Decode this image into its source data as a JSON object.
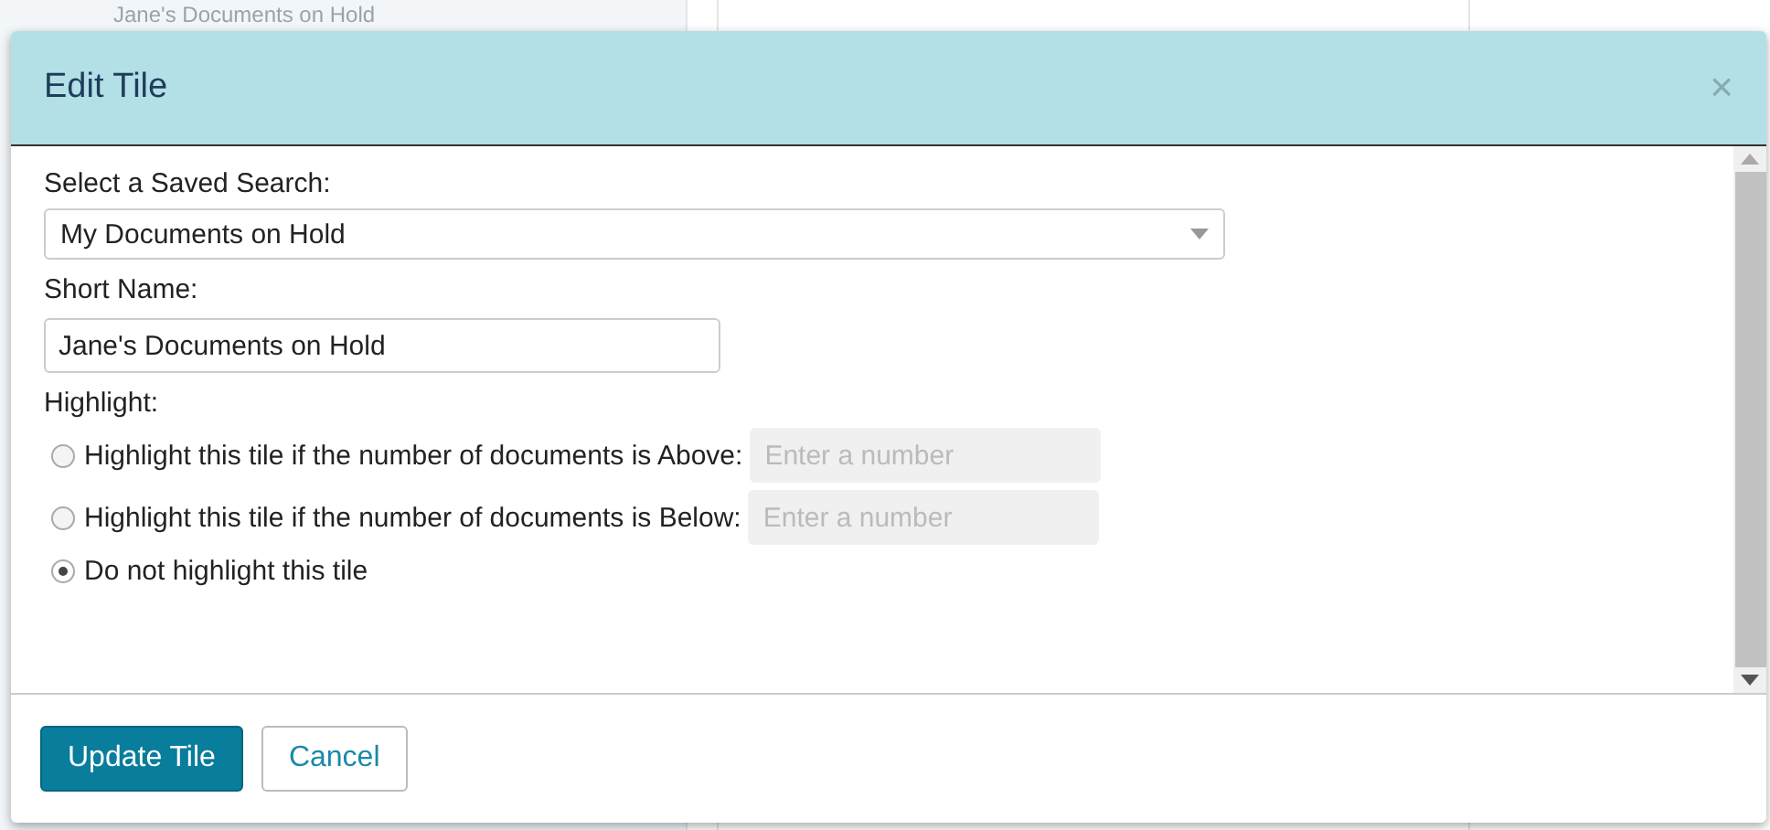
{
  "background": {
    "tile_name": "Jane's Documents on Hold"
  },
  "dialog": {
    "title": "Edit Tile",
    "close": "×"
  },
  "saved_search": {
    "label": "Select a Saved Search:",
    "value": "My Documents on Hold"
  },
  "short_name": {
    "label": "Short Name:",
    "value": "Jane's Documents on Hold"
  },
  "highlight": {
    "label": "Highlight:",
    "options": [
      {
        "label": "Highlight this tile if the number of documents is Above:",
        "selected": false,
        "placeholder": "Enter a number"
      },
      {
        "label": "Highlight this tile if the number of documents is Below:",
        "selected": false,
        "placeholder": "Enter a number"
      },
      {
        "label": "Do not highlight this tile",
        "selected": true
      }
    ]
  },
  "buttons": [
    {
      "label": "Update Tile",
      "kind": "primary"
    },
    {
      "label": "Cancel",
      "kind": "secondary"
    }
  ]
}
